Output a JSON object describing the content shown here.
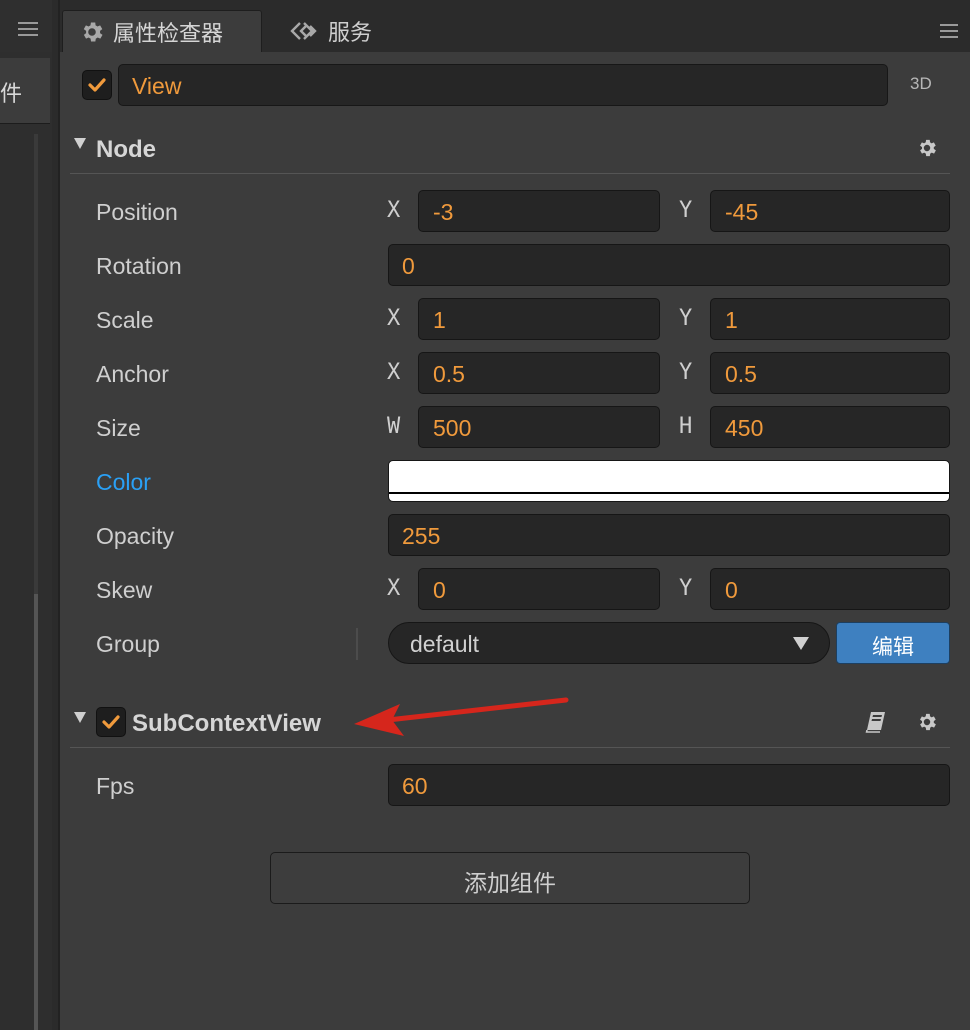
{
  "left_panel": {
    "tab_label": "件"
  },
  "tabs": [
    {
      "label": "属性检查器",
      "icon": "gear-icon"
    },
    {
      "label": "服务",
      "icon": "services-icon"
    }
  ],
  "node_header": {
    "name": "View",
    "enabled": true,
    "mode": "3D"
  },
  "node_section": {
    "title": "Node",
    "properties": {
      "position": {
        "label": "Position",
        "x_axis": "X",
        "x": "-3",
        "y_axis": "Y",
        "y": "-45"
      },
      "rotation": {
        "label": "Rotation",
        "value": "0"
      },
      "scale": {
        "label": "Scale",
        "x_axis": "X",
        "x": "1",
        "y_axis": "Y",
        "y": "1"
      },
      "anchor": {
        "label": "Anchor",
        "x_axis": "X",
        "x": "0.5",
        "y_axis": "Y",
        "y": "0.5"
      },
      "size": {
        "label": "Size",
        "w_axis": "W",
        "w": "500",
        "h_axis": "H",
        "h": "450"
      },
      "color": {
        "label": "Color",
        "value": "#ffffff"
      },
      "opacity": {
        "label": "Opacity",
        "value": "255"
      },
      "skew": {
        "label": "Skew",
        "x_axis": "X",
        "x": "0",
        "y_axis": "Y",
        "y": "0"
      },
      "group": {
        "label": "Group",
        "value": "default",
        "edit_label": "编辑"
      }
    }
  },
  "component_section": {
    "title": "SubContextView",
    "enabled": true,
    "properties": {
      "fps": {
        "label": "Fps",
        "value": "60"
      }
    }
  },
  "add_component_label": "添加组件",
  "colors": {
    "accent_orange": "#f09a3c",
    "link_blue": "#2aa0f5",
    "button_blue": "#3e80c0",
    "annotation_red": "#d6261c"
  }
}
